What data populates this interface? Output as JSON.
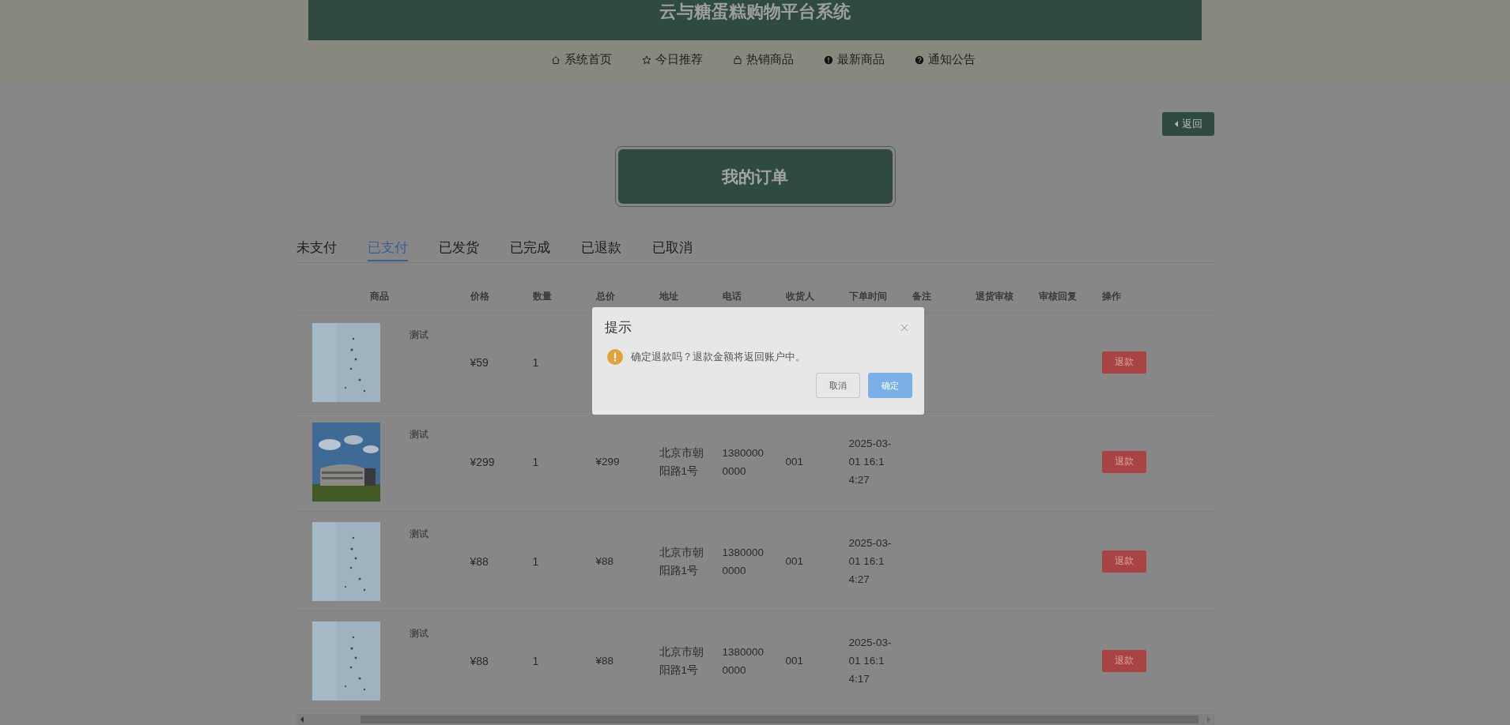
{
  "site_title": "云与糖蛋糕购物平台系统",
  "nav": [
    {
      "label": "系统首页",
      "kind": "home"
    },
    {
      "label": "今日推荐",
      "kind": "star"
    },
    {
      "label": "热销商品",
      "kind": "bag"
    },
    {
      "label": "最新商品",
      "kind": "alert"
    },
    {
      "label": "通知公告",
      "kind": "help"
    }
  ],
  "back_button": {
    "label": "返回"
  },
  "page_title": "我的订单",
  "tabs": [
    {
      "label": "未支付",
      "selected": false
    },
    {
      "label": "已支付",
      "selected": true
    },
    {
      "label": "已发货",
      "selected": false
    },
    {
      "label": "已完成",
      "selected": false
    },
    {
      "label": "已退款",
      "selected": false
    },
    {
      "label": "已取消",
      "selected": false
    }
  ],
  "table": {
    "columns": [
      "商品",
      "价格",
      "数量",
      "总价",
      "地址",
      "电话",
      "收货人",
      "下单时间",
      "备注",
      "退货审核",
      "审核回复",
      "操作"
    ],
    "rows": [
      {
        "name": "测试",
        "price": "¥59",
        "quantity": "1",
        "action": "退款"
      },
      {
        "name": "测试",
        "price": "¥299",
        "quantity": "1",
        "total": "¥299",
        "address": "北京市朝阳路1号",
        "phone": "13800000000",
        "receiver": "001",
        "date": "2025-03-01 16:14:27",
        "action": "退款"
      },
      {
        "name": "测试",
        "price": "¥88",
        "quantity": "1",
        "total": "¥88",
        "address": "北京市朝阳路1号",
        "phone": "13800000000",
        "receiver": "001",
        "date": "2025-03-01 16:14:27",
        "action": "退款"
      },
      {
        "name": "测试",
        "price": "¥88",
        "quantity": "1",
        "total": "¥88",
        "address": "北京市朝阳路1号",
        "phone": "13800000000",
        "receiver": "001",
        "date": "2025-03-01 16:14:17",
        "action": "退款"
      }
    ]
  },
  "dialog": {
    "title": "提示",
    "message": "确定退款吗？退款金额将返回账户中。",
    "buttons": [
      {
        "label": "取消",
        "kind": "default"
      },
      {
        "label": "确定",
        "kind": "primary"
      }
    ]
  }
}
